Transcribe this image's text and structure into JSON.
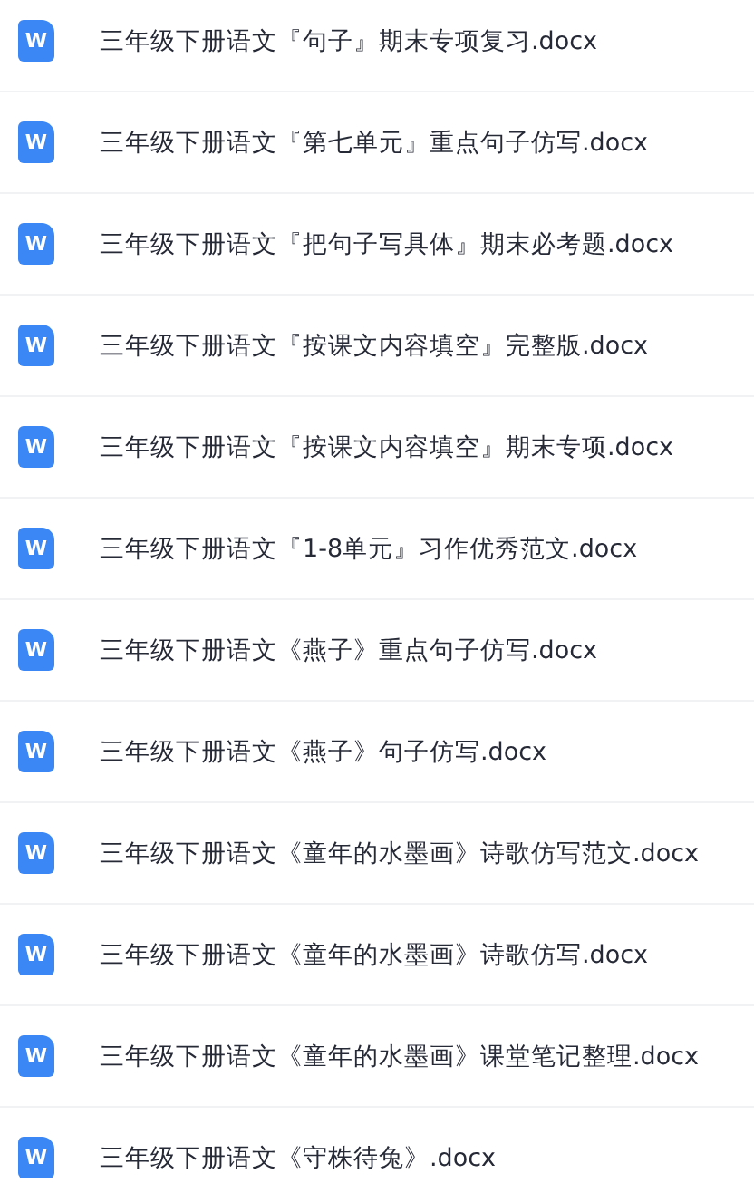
{
  "files": [
    {
      "name": "三年级下册语文『句子』期末专项复习.docx",
      "icon_label": "W"
    },
    {
      "name": "三年级下册语文『第七单元』重点句子仿写.docx",
      "icon_label": "W"
    },
    {
      "name": "三年级下册语文『把句子写具体』期末必考题.docx",
      "icon_label": "W"
    },
    {
      "name": "三年级下册语文『按课文内容填空』完整版.docx",
      "icon_label": "W"
    },
    {
      "name": "三年级下册语文『按课文内容填空』期末专项.docx",
      "icon_label": "W"
    },
    {
      "name": "三年级下册语文『1-8单元』习作优秀范文.docx",
      "icon_label": "W"
    },
    {
      "name": "三年级下册语文《燕子》重点句子仿写.docx",
      "icon_label": "W"
    },
    {
      "name": "三年级下册语文《燕子》句子仿写.docx",
      "icon_label": "W"
    },
    {
      "name": "三年级下册语文《童年的水墨画》诗歌仿写范文.docx",
      "icon_label": "W"
    },
    {
      "name": "三年级下册语文《童年的水墨画》诗歌仿写.docx",
      "icon_label": "W"
    },
    {
      "name": "三年级下册语文《童年的水墨画》课堂笔记整理.docx",
      "icon_label": "W"
    },
    {
      "name": "三年级下册语文《守株待兔》.docx",
      "icon_label": "W"
    }
  ]
}
